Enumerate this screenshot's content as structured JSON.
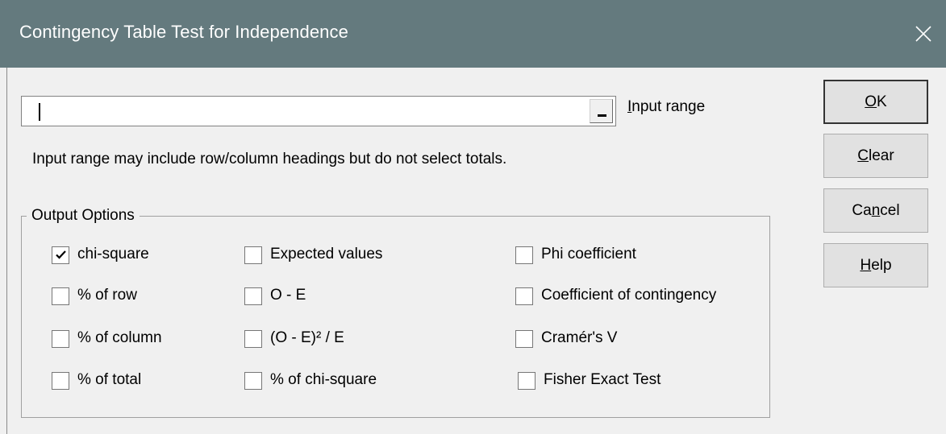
{
  "window": {
    "title": "Contingency Table Test for Independence"
  },
  "input": {
    "value": "",
    "label_prefix": "",
    "label_hot": "I",
    "label_rest": "nput range"
  },
  "hint": "Input range may include row/column headings but do not select totals.",
  "output_options": {
    "legend": "Output Options",
    "col1": [
      {
        "label": "chi-square",
        "checked": true
      },
      {
        "label": "% of row",
        "checked": false
      },
      {
        "label": "% of column",
        "checked": false
      },
      {
        "label": "% of total",
        "checked": false
      }
    ],
    "col2": [
      {
        "label": "Expected values",
        "checked": false
      },
      {
        "label": "O - E",
        "checked": false
      },
      {
        "label": "(O - E)² / E",
        "checked": false
      },
      {
        "label": "% of chi-square",
        "checked": false
      }
    ],
    "col3": [
      {
        "label": "Phi coefficient",
        "checked": false
      },
      {
        "label": "Coefficient of contingency",
        "checked": false
      },
      {
        "label": "Cramér's V",
        "checked": false
      },
      {
        "label": "Fisher Exact Test",
        "checked": false
      }
    ]
  },
  "buttons": {
    "ok": {
      "pre": "",
      "hot": "O",
      "post": "K"
    },
    "clear": {
      "pre": "",
      "hot": "C",
      "post": "lear"
    },
    "cancel": {
      "pre": "Ca",
      "hot": "n",
      "post": "cel"
    },
    "help": {
      "pre": "",
      "hot": "H",
      "post": "elp"
    }
  },
  "colors": {
    "titlebar": "#647a7e",
    "face": "#f0f0f0"
  }
}
